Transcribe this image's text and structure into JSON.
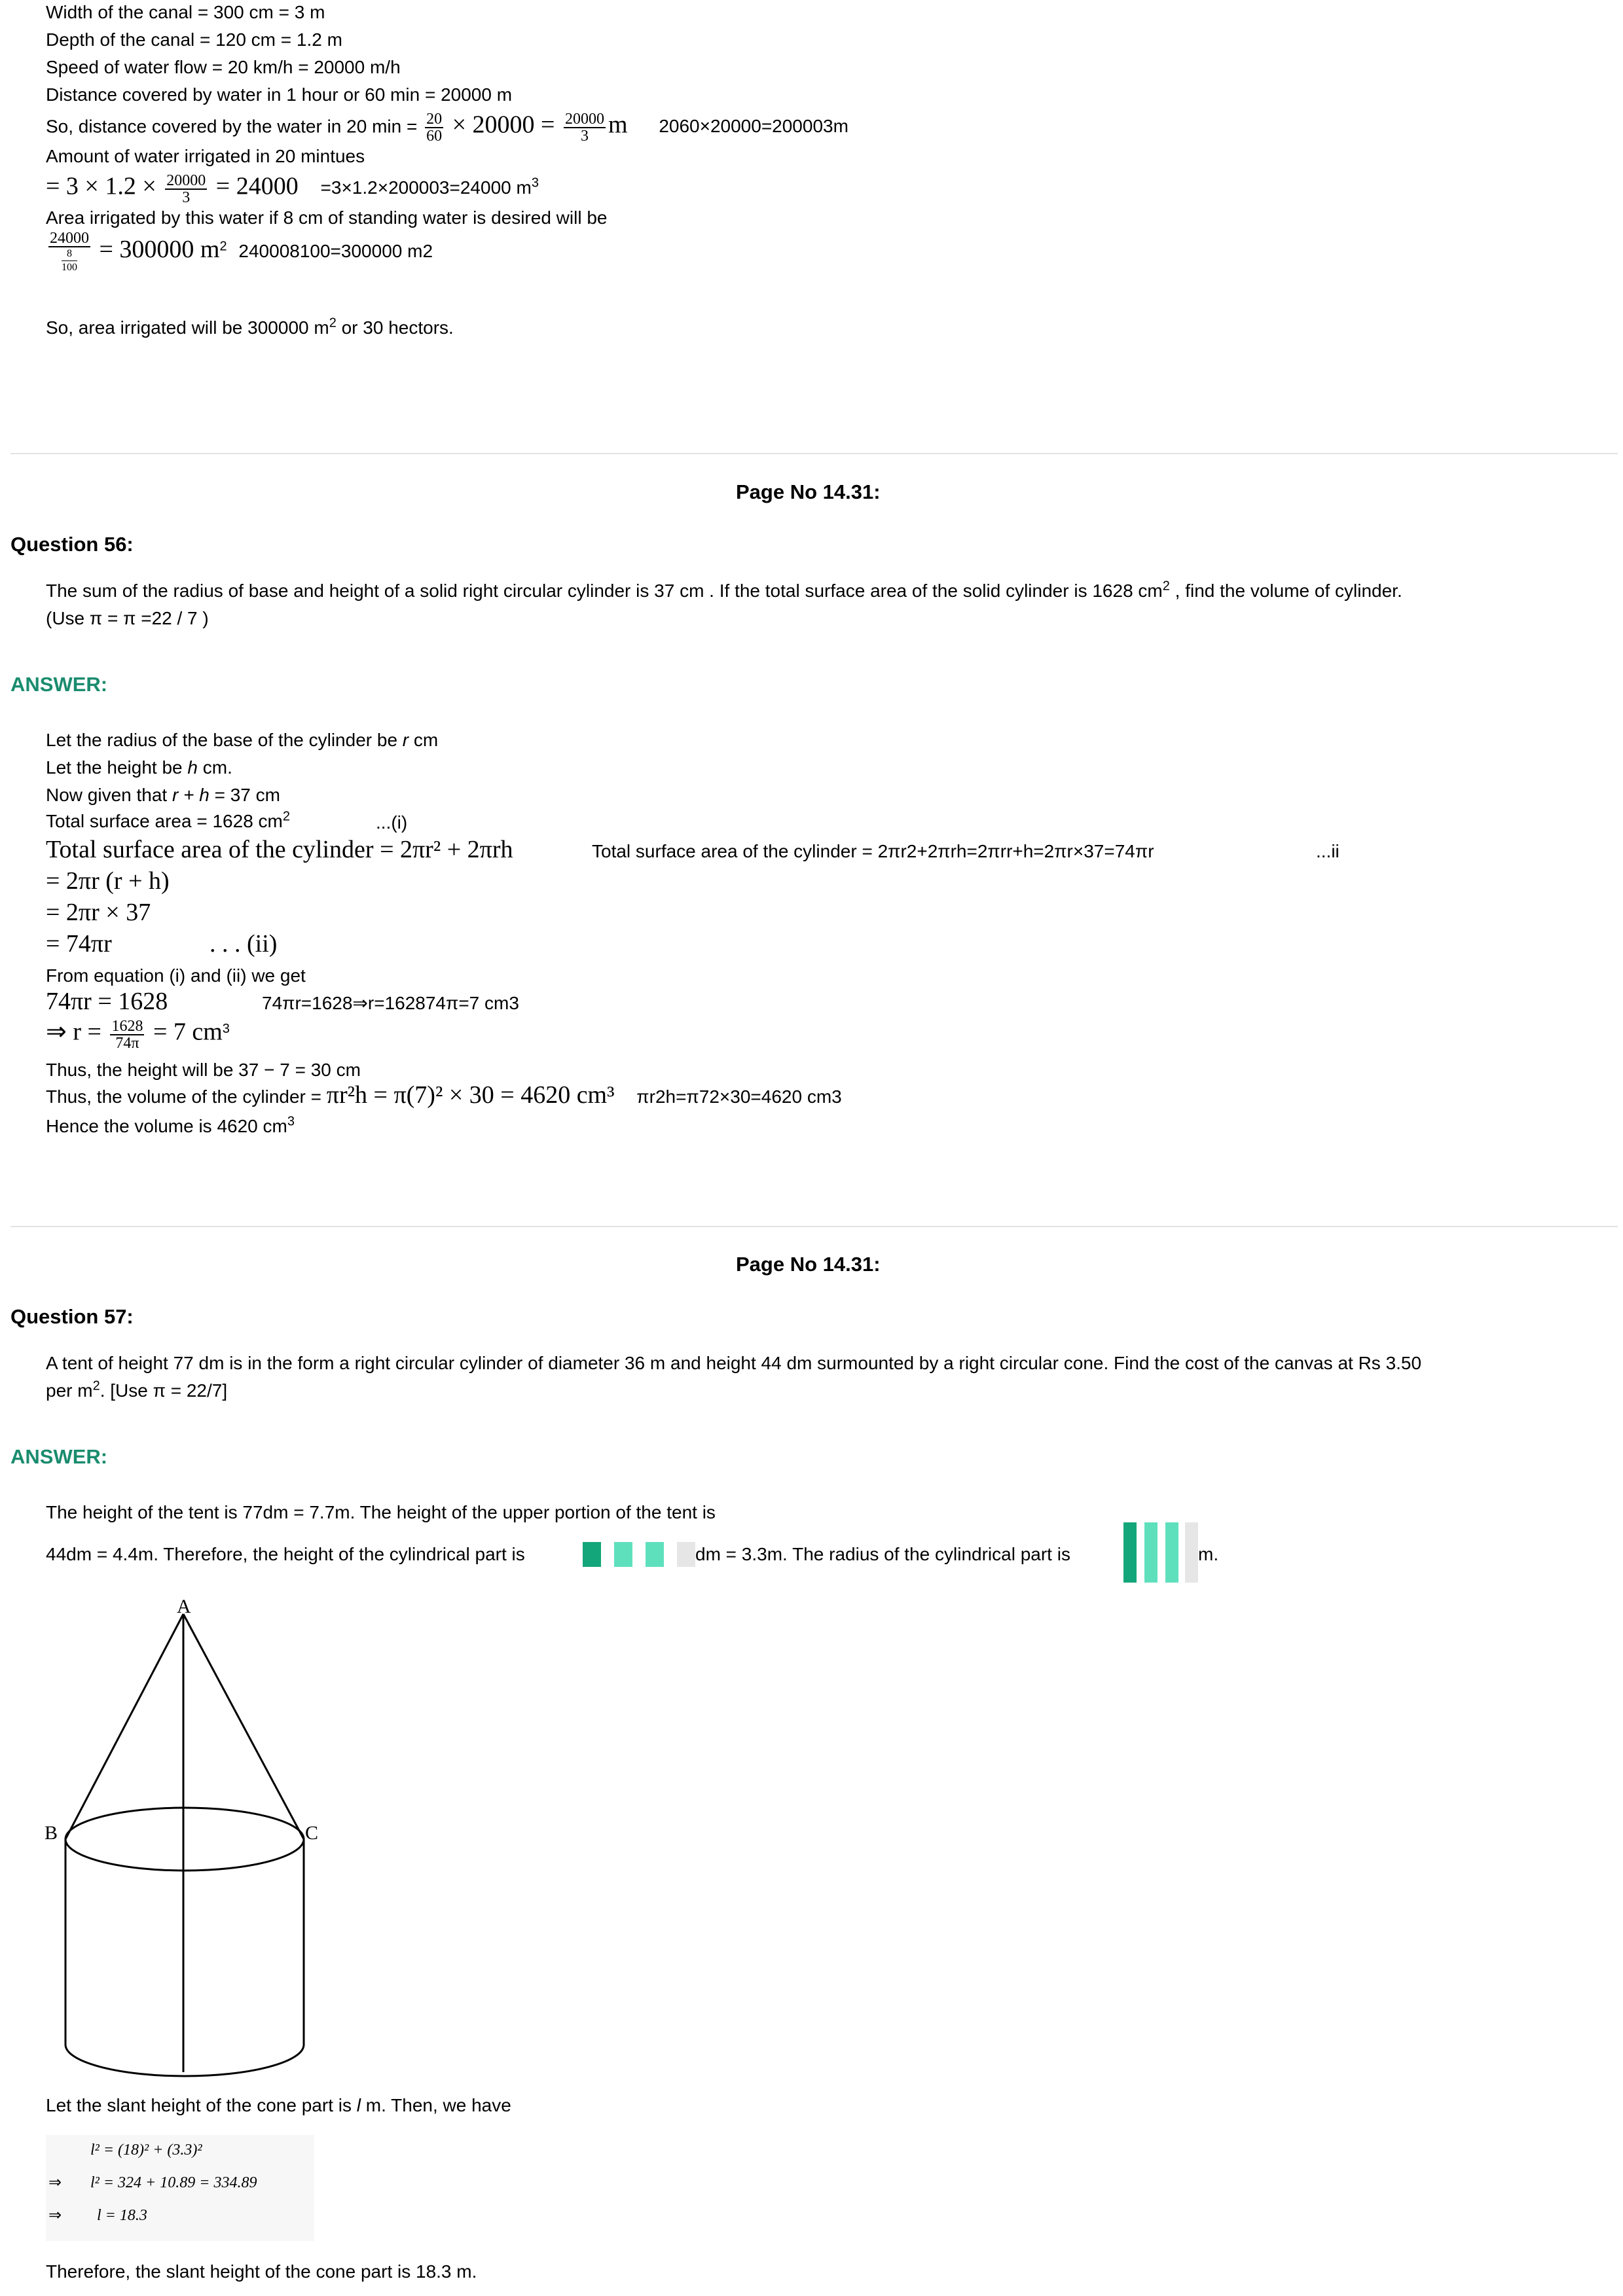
{
  "prev_answer": {
    "l1": "Width of the canal = 300 cm = 3 m",
    "l2": "Depth of the canal = 120 cm = 1.2 m",
    "l3": "Speed of water flow = 20 km/h = 20000 m/h",
    "l4": "Distance covered by water in 1 hour or 60 min = 20000 m",
    "l5_pre": "So, distance covered by the water in 20 min = ",
    "l5_f1n": "20",
    "l5_f1d": "60",
    "l5_mid": " × 20000 = ",
    "l5_f2n": "20000",
    "l5_f2d": "3",
    "l5_unit": "m",
    "l5_alt": "2060×20000=200003m",
    "l6": "Amount of water irrigated in 20 mintues",
    "l7_pre": "= 3 × 1.2 × ",
    "l7_fn": "20000",
    "l7_fd": "3",
    "l7_post": " = 24000",
    "l7_alt": "=3×1.2×200003=24000 m",
    "l7_alt_sup": "3",
    "l8": "Area irrigated by this water if 8 cm of standing water is desired will be",
    "l9_fn": "24000",
    "l9_fd_n": "8",
    "l9_fd_d": "100",
    "l9_post": " = 300000 m",
    "l9_sup": "2",
    "l9_alt": "240008100=300000 m2",
    "l10_pre": "So, area irrigated will be 300000 m",
    "l10_sup": "2",
    "l10_post": " or 30 hectors."
  },
  "q56": {
    "page_no": "Page No 14.31:",
    "heading": "Question 56:",
    "text1": "The sum of the radius of base and height of a solid right circular cylinder is 37 cm . If the total surface area of the solid cylinder is 1628 cm",
    "text1_sup": "2",
    "text1_post": " , find the volume of cylinder.",
    "text2": "(Use π  = π =22 / 7 )",
    "answer_label": "ANSWER:",
    "a1_pre": "Let the radius of the base of the cylinder be ",
    "a1_var": "r",
    "a1_post": " cm",
    "a2_pre": "Let the height be ",
    "a2_var": "h",
    "a2_post": " cm.",
    "a3_pre": "Now given that ",
    "a3_var": "r + h",
    "a3_post": " = 37 cm",
    "a4_pre": "Total surface area = 1628 cm",
    "a4_sup": "2",
    "a4_tag": "...(i)",
    "a5_math": "Total surface area of the cylinder  =  2πr² + 2πrh",
    "a5_alt": "Total surface area of the cylinder = 2πr2+2πrh=2πrr+h=2πr×37=74πr",
    "a5_tag": "...ii",
    "a6": "= 2πr (r + h)",
    "a7": "= 2πr × 37",
    "a8": "= 74πr",
    "a8_tag": ". . . (ii)",
    "a9": "From equation (i) and (ii) we get",
    "a10_math": "74πr = 1628",
    "a10_alt": "74πr=1628⇒r=162874π=7 cm3",
    "a11_pre": "⇒ r = ",
    "a11_fn": "1628",
    "a11_fd": "74π",
    "a11_post": " = 7  cm",
    "a11_sup": "3",
    "a12": "Thus, the height will be 37 − 7 = 30 cm",
    "a13_pre": "Thus, the volume of the cylinder = ",
    "a13_math": "πr²h = π(7)² × 30 = 4620  cm³",
    "a13_alt": "πr2h=π72×30=4620 cm3",
    "a14_pre": "Hence the volume is 4620 cm",
    "a14_sup": "3"
  },
  "q57": {
    "page_no": "Page No 14.31:",
    "heading": "Question 57:",
    "text1": "A tent of height 77 dm is in the form a right circular cylinder of diameter 36 m and height 44 dm surmounted by a right circular cone. Find the cost of the canvas at Rs 3.50",
    "text2_pre": "per m",
    "text2_sup": "2",
    "text2_post": ". [Use π = 22/7]",
    "answer_label": "ANSWER:",
    "a1": "The height of the tent is 77dm = 7.7m. The height of the upper portion of the tent is",
    "a2_pre": "44dm = 4.4m. Therefore, the height of the cylindrical part is",
    "a2_mid": "dm = 3.3m. The radius of the cylindrical part is",
    "a2_post": "m.",
    "fig_a": "A",
    "fig_b": "B",
    "fig_c": "C",
    "a3_pre": "Let the slant height of the cone part is ",
    "a3_var": "l",
    "a3_post": " m. Then, we have",
    "eq1": "l² = (18)² + (3.3)²",
    "eq2_arrow": "⇒",
    "eq2": "l² = 324 + 10.89 = 334.89",
    "eq3_arrow": "⇒",
    "eq3": "l = 18.3",
    "a4": "Therefore, the slant height of the cone part is 18.3 m."
  },
  "colors": {
    "accent": "#1a8c6e",
    "stripe_dark": "#13a67a",
    "stripe_light": "#5fe0bd",
    "stripe_grey": "#e6e6e6"
  }
}
